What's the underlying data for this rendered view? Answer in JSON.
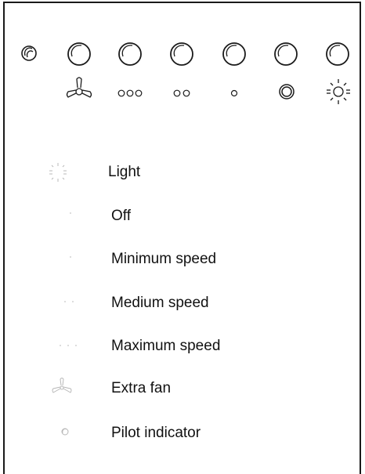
{
  "control_panel": {
    "buttons": [
      {
        "name": "pilot-indicator-lamp",
        "symbol": "pilot-lamp-icon"
      },
      {
        "name": "extra-fan-button",
        "symbol": "fan-icon"
      },
      {
        "name": "maximum-speed-button",
        "symbol": "three-dots-icon"
      },
      {
        "name": "medium-speed-button",
        "symbol": "two-dots-icon"
      },
      {
        "name": "minimum-speed-button",
        "symbol": "one-dot-icon"
      },
      {
        "name": "off-button",
        "symbol": "off-ring-icon"
      },
      {
        "name": "light-button",
        "symbol": "light-sun-icon"
      }
    ]
  },
  "legend": {
    "items": [
      {
        "id": "light",
        "label": "Light",
        "icon": "light-sun-icon"
      },
      {
        "id": "off",
        "label": "Off",
        "icon": "off-dot-icon"
      },
      {
        "id": "min",
        "label": "Minimum speed",
        "icon": "one-dot-icon"
      },
      {
        "id": "med",
        "label": "Medium speed",
        "icon": "two-dots-icon"
      },
      {
        "id": "max",
        "label": "Maximum speed",
        "icon": "three-dots-icon"
      },
      {
        "id": "fan",
        "label": "Extra fan",
        "icon": "fan-icon"
      },
      {
        "id": "pilot",
        "label": "Pilot indicator",
        "icon": "pilot-lamp-icon"
      }
    ]
  },
  "colors": {
    "stroke": "#1a1a1a",
    "legend_icon": "#b8b8b8"
  }
}
